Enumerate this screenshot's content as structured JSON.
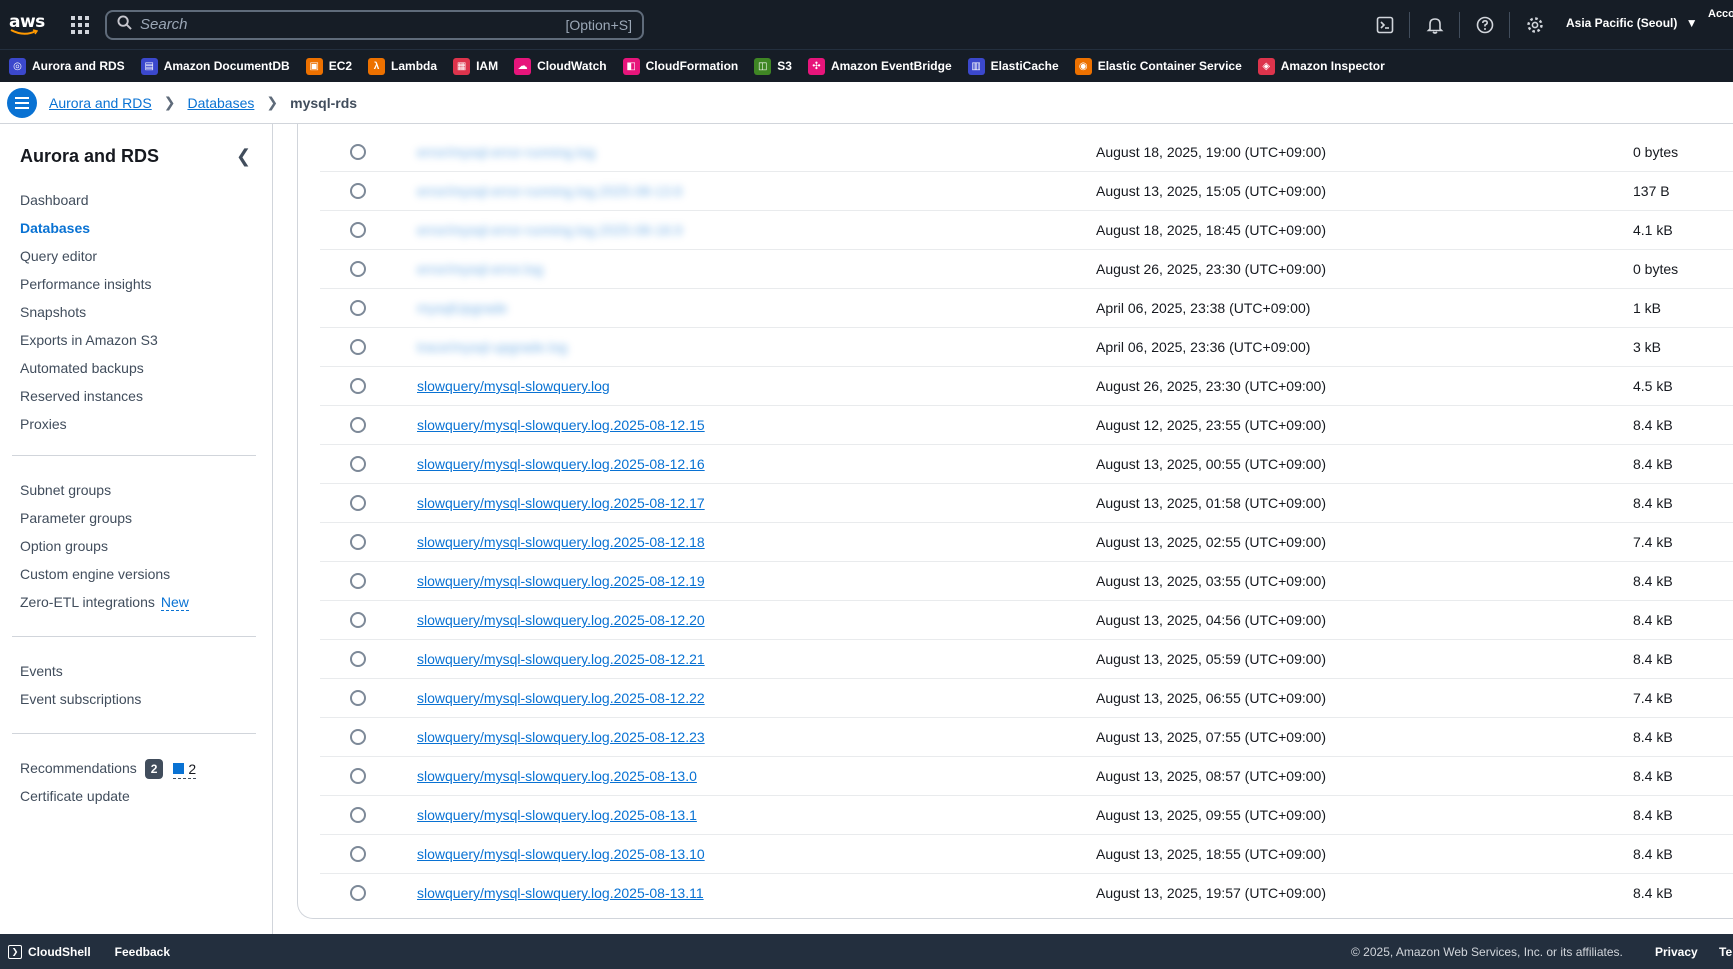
{
  "topnav": {
    "logo_text": "aws",
    "search_placeholder": "Search",
    "search_shortcut": "[Option+S]",
    "region": "Asia Pacific (Seoul)",
    "account": "Acco"
  },
  "favorites": [
    {
      "label": "Aurora and RDS",
      "icon": "rds-icon",
      "color": "#3b48cc",
      "glyph": "◎"
    },
    {
      "label": "Amazon DocumentDB",
      "icon": "documentdb-icon",
      "color": "#3b48cc",
      "glyph": "▤"
    },
    {
      "label": "EC2",
      "icon": "ec2-icon",
      "color": "#ed7100",
      "glyph": "▣"
    },
    {
      "label": "Lambda",
      "icon": "lambda-icon",
      "color": "#ed7100",
      "glyph": "λ"
    },
    {
      "label": "IAM",
      "icon": "iam-icon",
      "color": "#dd344c",
      "glyph": "▦"
    },
    {
      "label": "CloudWatch",
      "icon": "cloudwatch-icon",
      "color": "#e7157b",
      "glyph": "☁"
    },
    {
      "label": "CloudFormation",
      "icon": "cloudformation-icon",
      "color": "#e7157b",
      "glyph": "◧"
    },
    {
      "label": "S3",
      "icon": "s3-icon",
      "color": "#3f8624",
      "glyph": "◫"
    },
    {
      "label": "Amazon EventBridge",
      "icon": "eventbridge-icon",
      "color": "#e7157b",
      "glyph": "✣"
    },
    {
      "label": "ElastiCache",
      "icon": "elasticache-icon",
      "color": "#3b48cc",
      "glyph": "▥"
    },
    {
      "label": "Elastic Container Service",
      "icon": "ecs-icon",
      "color": "#ed7100",
      "glyph": "◉"
    },
    {
      "label": "Amazon Inspector",
      "icon": "inspector-icon",
      "color": "#dd344c",
      "glyph": "◈"
    }
  ],
  "breadcrumb": {
    "items": [
      "Aurora and RDS",
      "Databases"
    ],
    "current": "mysql-rds"
  },
  "sidebar": {
    "title": "Aurora and RDS",
    "group1": [
      "Dashboard",
      "Databases",
      "Query editor",
      "Performance insights",
      "Snapshots",
      "Exports in Amazon S3",
      "Automated backups",
      "Reserved instances",
      "Proxies"
    ],
    "group2": [
      "Subnet groups",
      "Parameter groups",
      "Option groups",
      "Custom engine versions",
      "Zero-ETL integrations"
    ],
    "new_label": "New",
    "group3": [
      "Events",
      "Event subscriptions"
    ],
    "group4": [
      "Recommendations",
      "Certificate update"
    ],
    "recommendations_count": "2",
    "recommendations_info_count": "2"
  },
  "logs": [
    {
      "name": "error/mysql-error-running.log",
      "updated": "August 18, 2025, 19:00 (UTC+09:00)",
      "size": "0 bytes",
      "redacted": true
    },
    {
      "name": "error/mysql-error-running.log.2025-08-13.6",
      "updated": "August 13, 2025, 15:05 (UTC+09:00)",
      "size": "137 B",
      "redacted": true
    },
    {
      "name": "error/mysql-error-running.log.2025-08-18.9",
      "updated": "August 18, 2025, 18:45 (UTC+09:00)",
      "size": "4.1 kB",
      "redacted": true
    },
    {
      "name": "error/mysql-error.log",
      "updated": "August 26, 2025, 23:30 (UTC+09:00)",
      "size": "0 bytes",
      "redacted": true
    },
    {
      "name": "mysqlUpgrade",
      "updated": "April 06, 2025, 23:38 (UTC+09:00)",
      "size": "1 kB",
      "redacted": true
    },
    {
      "name": "trace/mysql-upgrade.log",
      "updated": "April 06, 2025, 23:36 (UTC+09:00)",
      "size": "3 kB",
      "redacted": true
    },
    {
      "name": "slowquery/mysql-slowquery.log",
      "updated": "August 26, 2025, 23:30 (UTC+09:00)",
      "size": "4.5 kB",
      "redacted": false
    },
    {
      "name": "slowquery/mysql-slowquery.log.2025-08-12.15",
      "updated": "August 12, 2025, 23:55 (UTC+09:00)",
      "size": "8.4 kB",
      "redacted": false
    },
    {
      "name": "slowquery/mysql-slowquery.log.2025-08-12.16",
      "updated": "August 13, 2025, 00:55 (UTC+09:00)",
      "size": "8.4 kB",
      "redacted": false
    },
    {
      "name": "slowquery/mysql-slowquery.log.2025-08-12.17",
      "updated": "August 13, 2025, 01:58 (UTC+09:00)",
      "size": "8.4 kB",
      "redacted": false
    },
    {
      "name": "slowquery/mysql-slowquery.log.2025-08-12.18",
      "updated": "August 13, 2025, 02:55 (UTC+09:00)",
      "size": "7.4 kB",
      "redacted": false
    },
    {
      "name": "slowquery/mysql-slowquery.log.2025-08-12.19",
      "updated": "August 13, 2025, 03:55 (UTC+09:00)",
      "size": "8.4 kB",
      "redacted": false
    },
    {
      "name": "slowquery/mysql-slowquery.log.2025-08-12.20",
      "updated": "August 13, 2025, 04:56 (UTC+09:00)",
      "size": "8.4 kB",
      "redacted": false
    },
    {
      "name": "slowquery/mysql-slowquery.log.2025-08-12.21",
      "updated": "August 13, 2025, 05:59 (UTC+09:00)",
      "size": "8.4 kB",
      "redacted": false
    },
    {
      "name": "slowquery/mysql-slowquery.log.2025-08-12.22",
      "updated": "August 13, 2025, 06:55 (UTC+09:00)",
      "size": "7.4 kB",
      "redacted": false
    },
    {
      "name": "slowquery/mysql-slowquery.log.2025-08-12.23",
      "updated": "August 13, 2025, 07:55 (UTC+09:00)",
      "size": "8.4 kB",
      "redacted": false
    },
    {
      "name": "slowquery/mysql-slowquery.log.2025-08-13.0",
      "updated": "August 13, 2025, 08:57 (UTC+09:00)",
      "size": "8.4 kB",
      "redacted": false
    },
    {
      "name": "slowquery/mysql-slowquery.log.2025-08-13.1",
      "updated": "August 13, 2025, 09:55 (UTC+09:00)",
      "size": "8.4 kB",
      "redacted": false
    },
    {
      "name": "slowquery/mysql-slowquery.log.2025-08-13.10",
      "updated": "August 13, 2025, 18:55 (UTC+09:00)",
      "size": "8.4 kB",
      "redacted": false
    },
    {
      "name": "slowquery/mysql-slowquery.log.2025-08-13.11",
      "updated": "August 13, 2025, 19:57 (UTC+09:00)",
      "size": "8.4 kB",
      "redacted": false
    }
  ],
  "footer": {
    "cloudshell": "CloudShell",
    "feedback": "Feedback",
    "copyright": "© 2025, Amazon Web Services, Inc. or its affiliates.",
    "privacy": "Privacy",
    "terms": "Te"
  }
}
